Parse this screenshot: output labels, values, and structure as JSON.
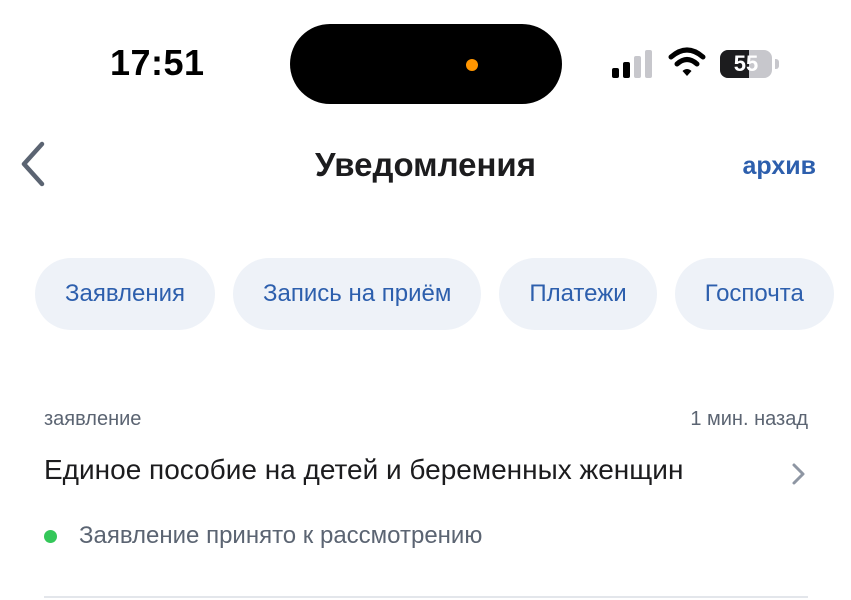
{
  "status_bar": {
    "time": "17:51",
    "battery_level": "55",
    "battery_fraction": 0.55,
    "camera_dot_color": "#ff9500",
    "signal_icon": "cellular-signal-icon",
    "wifi_icon": "wifi-icon"
  },
  "header": {
    "back_icon": "chevron-left-icon",
    "title": "Уведомления",
    "archive_label": "архив"
  },
  "filters": {
    "chips": [
      {
        "label": "Заявления"
      },
      {
        "label": "Запись на приём"
      },
      {
        "label": "Платежи"
      },
      {
        "label": "Госпочта"
      }
    ]
  },
  "notifications": [
    {
      "type": "заявление",
      "time": "1 мин. назад",
      "title": "Единое пособие на детей и беременных женщин",
      "status": "Заявление принято к рассмотрению",
      "status_color": "#34c759",
      "chevron_icon": "chevron-right-icon"
    }
  ],
  "colors": {
    "accent": "#2d5fad",
    "chip_background": "#eef2f8",
    "secondary_text": "#5b6472"
  }
}
